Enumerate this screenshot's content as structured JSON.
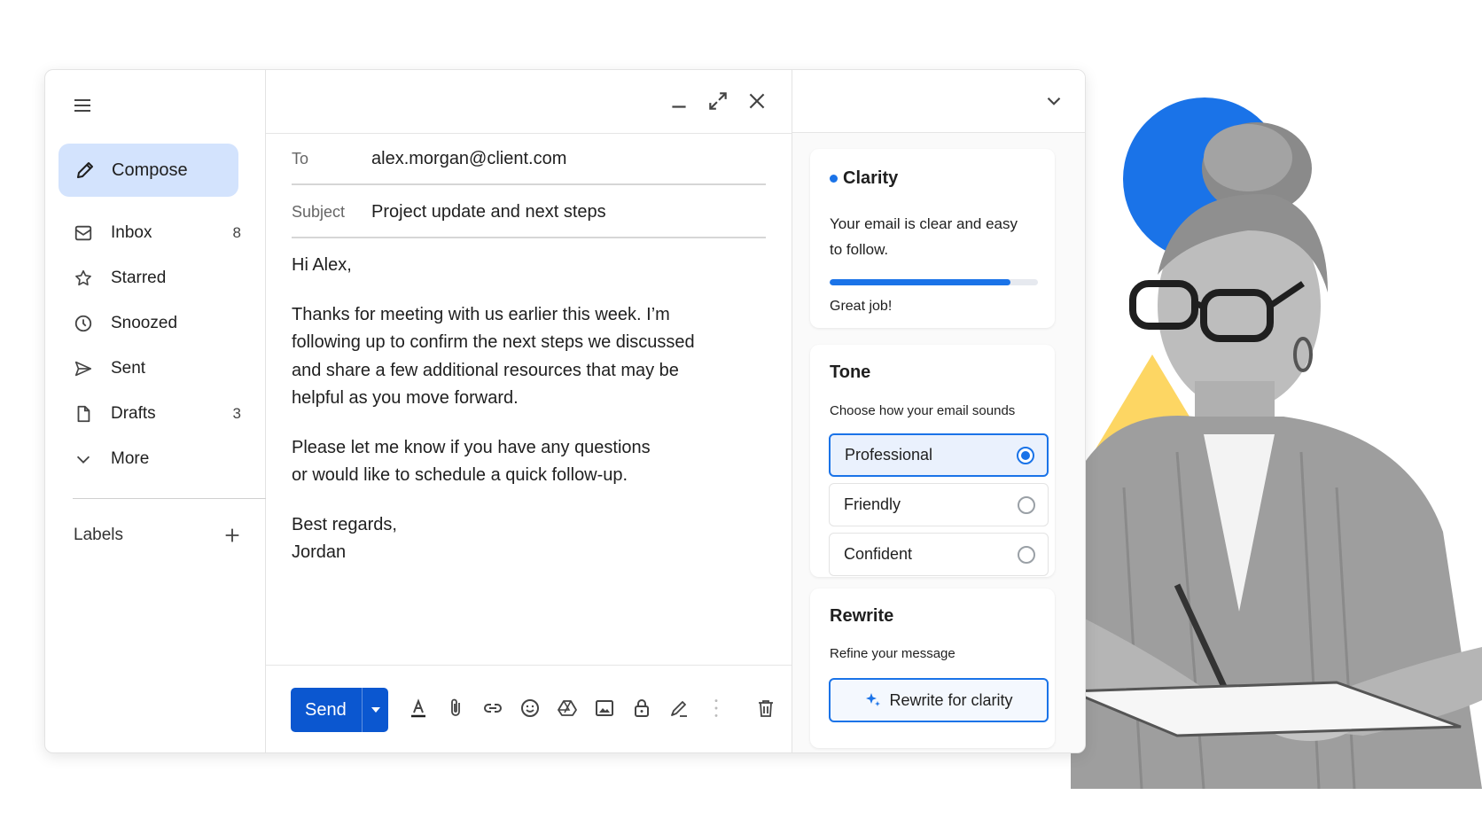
{
  "sidebar": {
    "compose_label": "Compose",
    "items": [
      {
        "icon": "inbox-icon",
        "label": "Inbox",
        "count": "8"
      },
      {
        "icon": "star-icon",
        "label": "Starred",
        "count": ""
      },
      {
        "icon": "clock-icon",
        "label": "Snoozed",
        "count": ""
      },
      {
        "icon": "send-icon",
        "label": "Sent",
        "count": ""
      },
      {
        "icon": "draft-icon",
        "label": "Drafts",
        "count": "3"
      },
      {
        "icon": "chevron-down-icon",
        "label": "More",
        "count": ""
      }
    ],
    "labels_heading": "Labels"
  },
  "compose": {
    "to_label": "To",
    "to_value": "alex.morgan@client.com",
    "subject_label": "Subject",
    "subject_value": "Project update and next steps",
    "body": {
      "greeting": "Hi Alex,",
      "p1_l1": "Thanks for meeting with us earlier this week. I’m",
      "p1_l2": "following up to confirm the next steps we discussed",
      "p1_l3": "and share a few additional resources that may be",
      "p1_l4": "helpful as you move forward.",
      "p2_l1": "Please let me know if you have any questions",
      "p2_l2": "or would like to schedule a quick follow-up.",
      "signoff": "Best regards,",
      "name": "Jordan"
    },
    "send_label": "Send",
    "toolbar_icons": [
      "text-format-icon",
      "attach-icon",
      "link-icon",
      "emoji-icon",
      "drive-icon",
      "image-icon",
      "lock-icon",
      "signature-icon",
      "more-vert-icon",
      "trash-icon"
    ]
  },
  "assistant": {
    "clarity": {
      "title": "Clarity",
      "text_l1": "Your email is clear and easy",
      "text_l2": "to follow.",
      "progress": 0.87,
      "footer": "Great job!"
    },
    "tone": {
      "title": "Tone",
      "subtitle": "Choose how your email sounds",
      "options": [
        {
          "label": "Professional",
          "selected": true
        },
        {
          "label": "Friendly",
          "selected": false
        },
        {
          "label": "Confident",
          "selected": false
        }
      ]
    },
    "rewrite": {
      "title": "Rewrite",
      "subtitle": "Refine your message",
      "button_label": "Rewrite for clarity"
    }
  },
  "colors": {
    "accent": "#1a73e8",
    "send": "#0b57d0",
    "compose_bg": "#d3e3fd",
    "deco_yellow": "#fdd663"
  }
}
